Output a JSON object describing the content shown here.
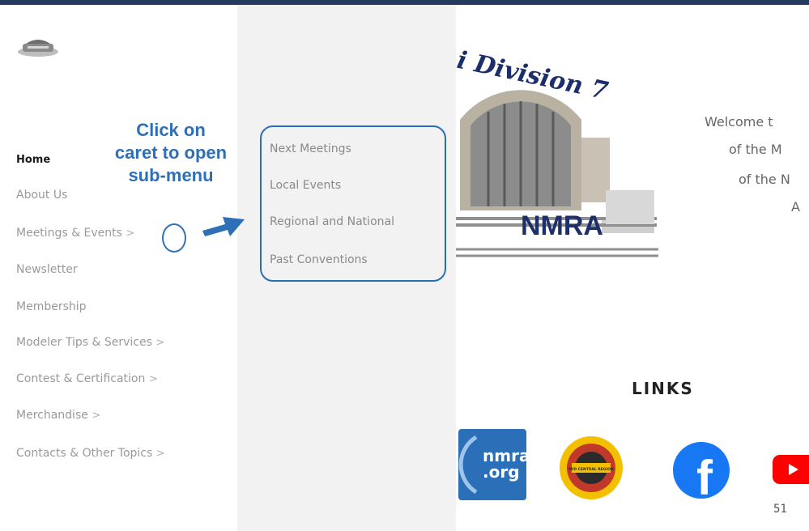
{
  "nav": {
    "items": [
      {
        "label": "Home",
        "caret": ""
      },
      {
        "label": "About Us",
        "caret": ""
      },
      {
        "label": "Meetings & Events",
        "caret": ">"
      },
      {
        "label": "Newsletter",
        "caret": ""
      },
      {
        "label": "Membership",
        "caret": ""
      },
      {
        "label": "Modeler Tips & Services",
        "caret": ">"
      },
      {
        "label": "Contest & Certification",
        "caret": ">"
      },
      {
        "label": "Merchandise",
        "caret": ">"
      },
      {
        "label": "Contacts & Other Topics",
        "caret": ">"
      }
    ]
  },
  "submenu": {
    "items": [
      "Next Meetings",
      "Local Events",
      "Regional and National",
      "Past Conventions"
    ]
  },
  "callout": {
    "line1": "Click on",
    "line2": "caret to open",
    "line3": "sub-menu"
  },
  "hero": {
    "banner_text": "i Division 7",
    "org_text": "NMRA"
  },
  "welcome": {
    "line1": "Welcome t",
    "line2": "of the M",
    "line3": "of the N",
    "line4": "A"
  },
  "links": {
    "title": "LINKS",
    "nmra_line1": "nmra",
    "nmra_line2": ".org",
    "region_badge": "MID CENTRAL REGION",
    "facebook_glyph": "f"
  },
  "slide": {
    "page_number": "51"
  },
  "colors": {
    "annotation_blue": "#2e70b7",
    "top_bar": "#243a5e",
    "submenu_bg": "#f2f2f2",
    "facebook_blue": "#1877f2",
    "youtube_red": "#ff0000"
  }
}
